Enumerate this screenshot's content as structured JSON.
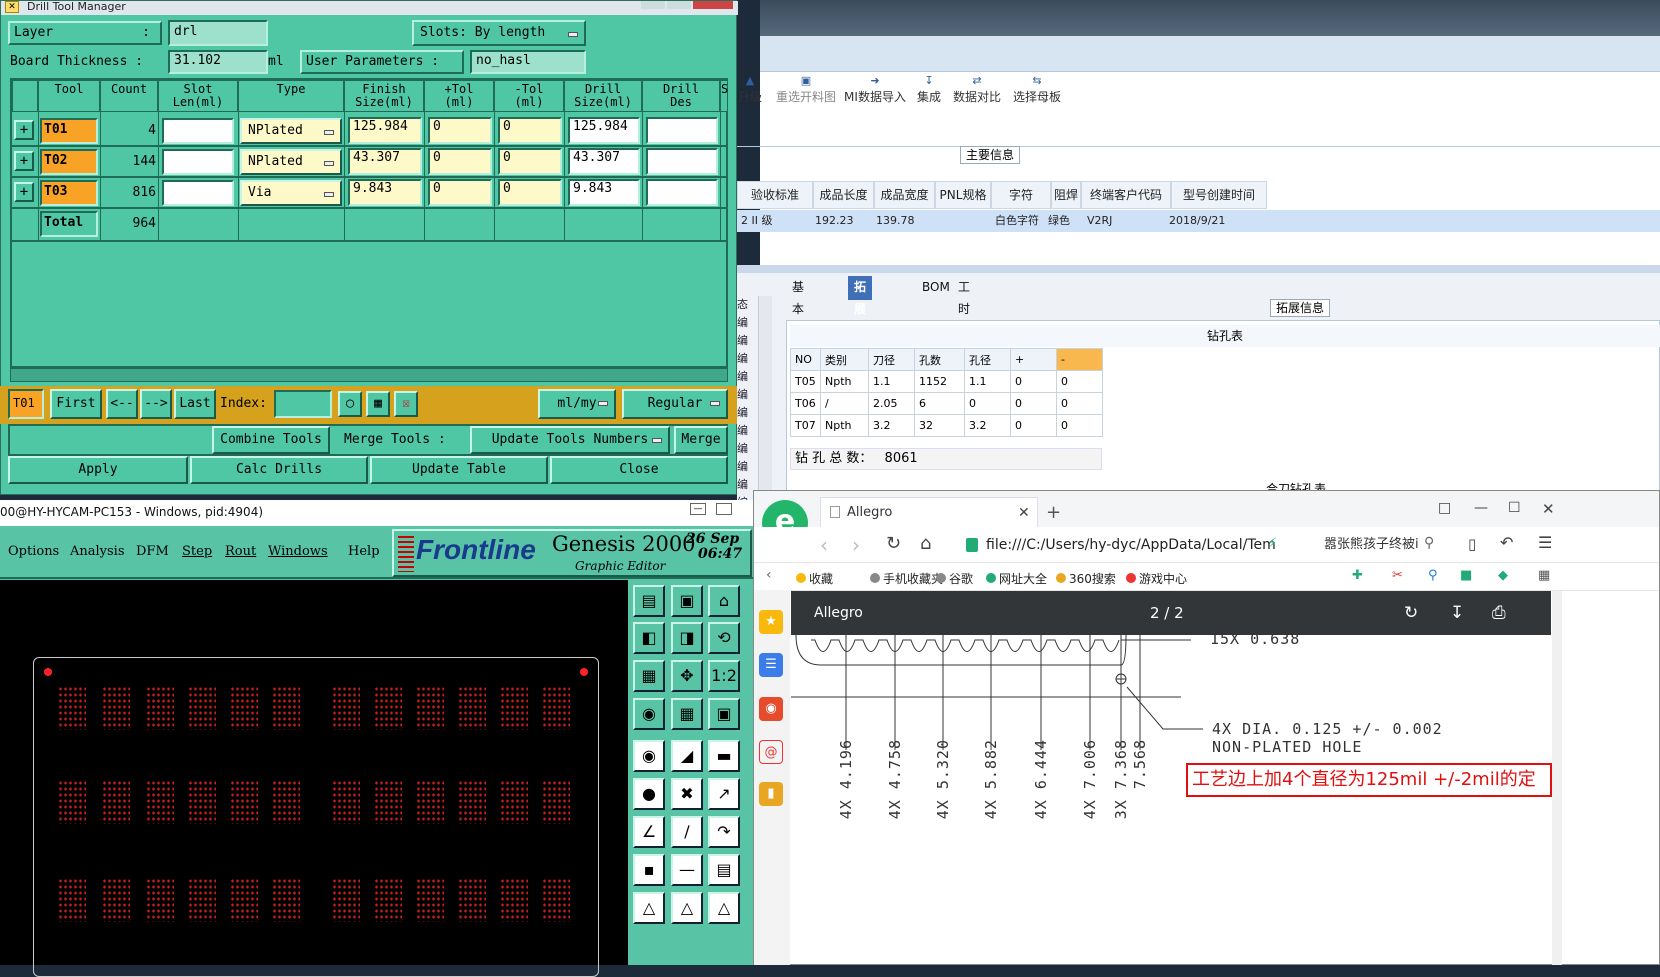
{
  "dtm": {
    "title": "Drill Tool Manager",
    "layer_label": "Layer",
    "layer_colon": ":",
    "layer_value": "drl",
    "slots_label": "Slots:",
    "slots_value": "By length",
    "thickness_label": "Board Thickness :",
    "thickness_value": "31.102",
    "thickness_unit": "ml",
    "user_params_label": "User Parameters :",
    "user_params_value": "no_hasl",
    "headers": [
      "Tool",
      "Count",
      "Slot\nLen(ml)",
      "Type",
      "Finish\nSize(ml)",
      "+Tol\n(ml)",
      "-Tol\n(ml)",
      "Drill\nSize(ml)",
      "Drill\nDes",
      "S"
    ],
    "rows": [
      {
        "tool": "T01",
        "count": "4",
        "slot": "",
        "type": "NPlated",
        "finish": "125.984",
        "ptol": "0",
        "ntol": "0",
        "drill": "125.984",
        "des": ""
      },
      {
        "tool": "T02",
        "count": "144",
        "slot": "",
        "type": "NPlated",
        "finish": "43.307",
        "ptol": "0",
        "ntol": "0",
        "drill": "43.307",
        "des": ""
      },
      {
        "tool": "T03",
        "count": "816",
        "slot": "",
        "type": "Via",
        "finish": "9.843",
        "ptol": "0",
        "ntol": "0",
        "drill": "9.843",
        "des": ""
      }
    ],
    "total_label": "Total",
    "total_count": "964",
    "nav": {
      "current": "T01",
      "first": "First",
      "prev": "<--",
      "next": "-->",
      "last": "Last",
      "index_label": "Index:",
      "unit": "ml/my",
      "mode": "Regular"
    },
    "actions": {
      "combine": "Combine Tools",
      "merge_label": "Merge Tools :",
      "update_numbers": "Update Tools Numbers",
      "merge": "Merge",
      "apply": "Apply",
      "calc": "Calc Drills",
      "update_table": "Update Table",
      "close": "Close"
    }
  },
  "genesis": {
    "title": "00@HY-HYCAM-PC153 - Windows, pid:4904)",
    "menus": [
      "Options",
      "Analysis",
      "DFM",
      "Step",
      "Rout",
      "Windows",
      "Help"
    ],
    "brand": "Frontline",
    "product": "Genesis 2000",
    "subtitle": "Graphic Editor",
    "date": "26 Sep",
    "time": "06:47"
  },
  "erp": {
    "toolbar": [
      "升级",
      "重选开料图",
      "MI数据导入",
      "集成",
      "数据对比",
      "选择母板"
    ],
    "main_info": "主要信息",
    "cols": [
      "验收标准",
      "成品长度",
      "成品宽度",
      "PNL规格",
      "字符",
      "阻焊",
      "终端客户代码",
      "型号创建时间"
    ],
    "row": [
      "2 II 级",
      "192.23",
      "139.78",
      "",
      "白色字符",
      "绿色",
      "V2RJ",
      "2018/9/21"
    ],
    "tabs": [
      "基本信息",
      "拓展信息",
      "BOM",
      "工时"
    ],
    "ext_info": "拓展信息",
    "drill_table_title": "钻孔表",
    "drill_headers": [
      "NO",
      "类别",
      "刀径",
      "孔数",
      "孔径",
      "+",
      "-"
    ],
    "drill_rows": [
      [
        "T05",
        "Npth",
        "1.1",
        "1152",
        "1.1",
        "0",
        "0"
      ],
      [
        "T06",
        "/",
        "2.05",
        "6",
        "0",
        "0",
        "0"
      ],
      [
        "T07",
        "Npth",
        "3.2",
        "32",
        "3.2",
        "0",
        "0"
      ]
    ],
    "total_holes_label": "钻 孔 总 数：",
    "total_holes": "8061",
    "merge_table": "合刀钻孔表",
    "side_labels": [
      "态",
      "编",
      "编",
      "编",
      "编",
      "编",
      "编",
      "编",
      "编",
      "编",
      "编",
      "编",
      "编"
    ]
  },
  "browser": {
    "tab_title": "Allegro",
    "url": "file:///C:/Users/hy-dyc/AppData/Local/Tem",
    "search_text": "嚣张熊孩子终被i",
    "bookmarks": [
      "收藏",
      "手机收藏夹",
      "谷歌",
      "网址大全",
      "360搜索",
      "游戏中心"
    ],
    "pdf_title": "Allegro",
    "pdf_page": "2 / 2",
    "drawing": {
      "top_text": "15X 0.638",
      "note1": "4X DIA. 0.125 +/- 0.002",
      "note2": "NON-PLATED HOLE",
      "dims": [
        "4X 4.196",
        "4X 4.758",
        "4X 5.320",
        "4X 5.882",
        "4X 6.444",
        "4X 7.006",
        "3X 7.368",
        "7.568"
      ],
      "annotation": "工艺边上加4个直径为125mil +/-2mil的定"
    }
  }
}
